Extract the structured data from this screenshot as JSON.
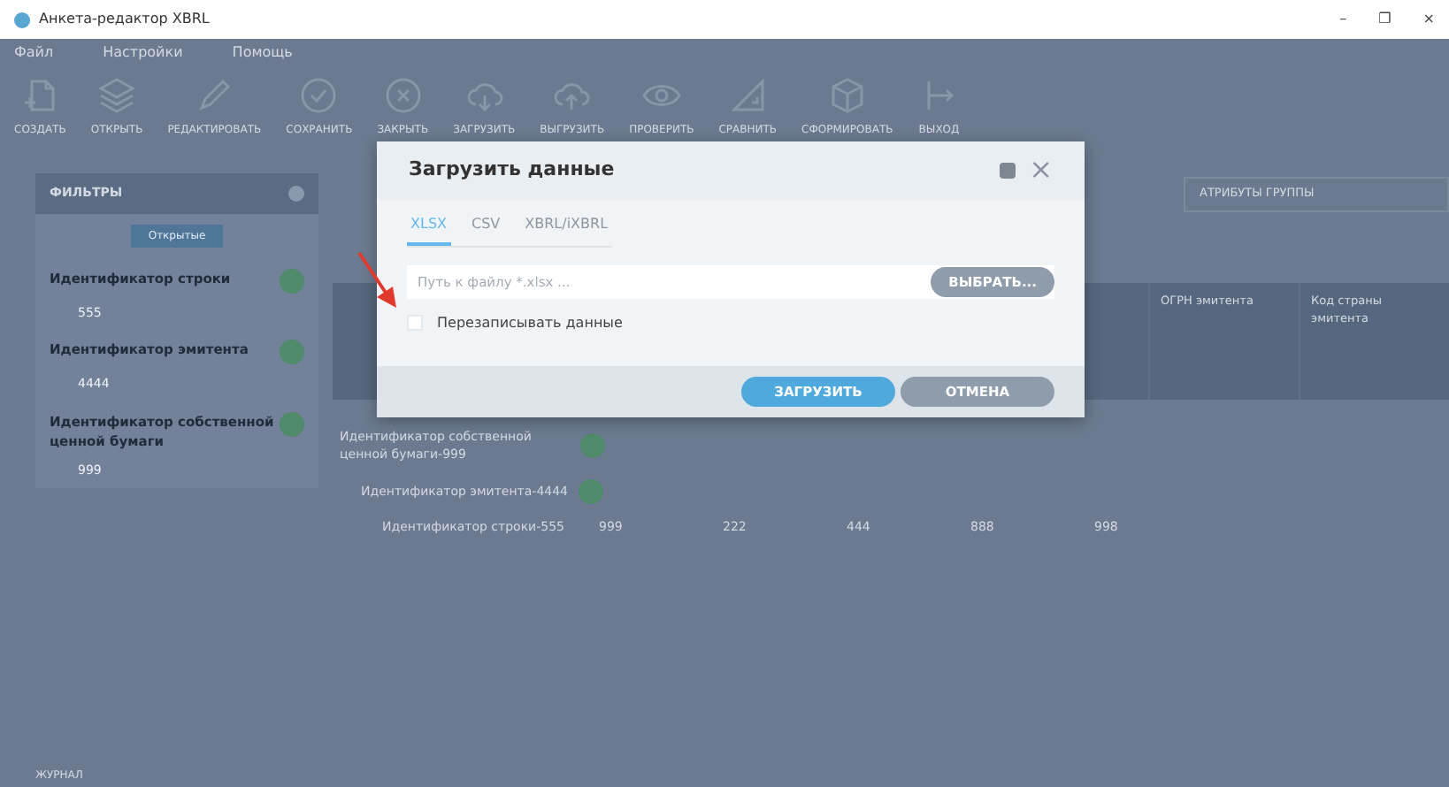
{
  "window": {
    "title": "Анкета-редактор XBRL",
    "controls": [
      "–",
      "❐",
      "×"
    ]
  },
  "menu": [
    "Файл",
    "Настройки",
    "Помощь"
  ],
  "toolbar": [
    {
      "kind": "file",
      "label": "СОЗДАТЬ"
    },
    {
      "kind": "layers",
      "label": "ОТКРЫТЬ"
    },
    {
      "kind": "pencil",
      "label": "РЕДАКТИРОВАТЬ"
    },
    {
      "kind": "check",
      "label": "СОХРАНИТЬ"
    },
    {
      "kind": "cross",
      "label": "ЗАКРЫТЬ"
    },
    {
      "kind": "download",
      "label": "ЗАГРУЗИТЬ"
    },
    {
      "kind": "upload",
      "label": "ВЫГРУЗИТЬ"
    },
    {
      "kind": "eye",
      "label": "ПРОВЕРИТЬ"
    },
    {
      "kind": "ruler",
      "label": "СРАВНИТЬ"
    },
    {
      "kind": "cube",
      "label": "СФОРМИРОВАТЬ"
    },
    {
      "kind": "exit",
      "label": "ВЫХОД"
    }
  ],
  "filters": {
    "title": "ФИЛЬТРЫ",
    "tab": "Открытые",
    "items": [
      {
        "label": "Идентификатор строки",
        "value": "555"
      },
      {
        "label": "Идентификатор эмитента",
        "value": "4444"
      },
      {
        "label": "Идентификатор собственной ценной бумаги",
        "value": "999"
      }
    ]
  },
  "group_select": "АТРИБУТЫ ГРУППЫ",
  "table": {
    "columns": [
      "ОГРН эмитента",
      "Код страны эмитента"
    ],
    "tree": [
      {
        "label": "Идентификатор собственной ценной бумаги-999",
        "children": [
          {
            "label": "Идентификатор эмитента-4444",
            "children": [
              {
                "label": "Идентификатор строки-555",
                "cells": [
                  "999",
                  "222",
                  "444",
                  "888",
                  "998"
                ]
              }
            ]
          }
        ]
      }
    ]
  },
  "journal": {
    "title": "ЖУРНАЛ"
  },
  "dialog": {
    "title": "Загрузить данные",
    "tabs": [
      {
        "label": "XLSX",
        "selected": true
      },
      {
        "label": "CSV",
        "selected": false
      },
      {
        "label": "XBRL/iXBRL",
        "selected": false
      }
    ],
    "close": "×",
    "path": {
      "placeholder": "Путь к файлу *.xlsx ..."
    },
    "browse": "ВЫБРАТЬ...",
    "overwrite": {
      "label": "Перезаписывать данные",
      "checked": false
    },
    "buttons": [
      {
        "kind": "primary",
        "label": "ЗАГРУЗИТЬ"
      },
      {
        "kind": "secondary",
        "label": "ОТМЕНА"
      }
    ]
  }
}
